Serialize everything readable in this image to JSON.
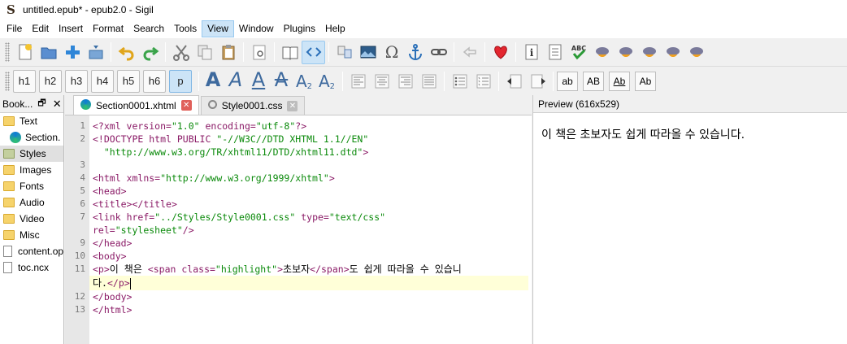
{
  "window": {
    "title": "untitled.epub* - epub2.0 - Sigil",
    "app_icon_glyph": "S"
  },
  "menu": [
    "File",
    "Edit",
    "Insert",
    "Format",
    "Search",
    "Tools",
    "View",
    "Window",
    "Plugins",
    "Help"
  ],
  "menu_active": "View",
  "heading_buttons": [
    "h1",
    "h2",
    "h3",
    "h4",
    "h5",
    "h6",
    "p"
  ],
  "format_glyphs": [
    "A",
    "A",
    "A",
    "A",
    "A",
    "A"
  ],
  "format_subscript": "2",
  "format_superscript": "2",
  "case_buttons": [
    "ab",
    "AB",
    "Ab",
    "Ab"
  ],
  "book_browser": {
    "title": "Book...",
    "items": [
      {
        "label": "Text",
        "kind": "folder"
      },
      {
        "label": "Section.",
        "kind": "xhtml"
      },
      {
        "label": "Styles",
        "kind": "folder-selected"
      },
      {
        "label": "Images",
        "kind": "folder"
      },
      {
        "label": "Fonts",
        "kind": "folder"
      },
      {
        "label": "Audio",
        "kind": "folder"
      },
      {
        "label": "Video",
        "kind": "folder"
      },
      {
        "label": "Misc",
        "kind": "folder"
      },
      {
        "label": "content.op",
        "kind": "file"
      },
      {
        "label": "toc.ncx",
        "kind": "file"
      }
    ]
  },
  "tabs": [
    {
      "label": "Section0001.xhtml",
      "active": true
    },
    {
      "label": "Style0001.css",
      "active": false
    }
  ],
  "code_lines": [
    {
      "n": "1",
      "text": "<?xml version=\"1.0\" encoding=\"utf-8\"?>"
    },
    {
      "n": "2",
      "text": "<!DOCTYPE html PUBLIC \"-//W3C//DTD XHTML 1.1//EN\""
    },
    {
      "n": "",
      "text": "  \"http://www.w3.org/TR/xhtml11/DTD/xhtml11.dtd\">"
    },
    {
      "n": "3",
      "text": ""
    },
    {
      "n": "4",
      "text": "<html xmlns=\"http://www.w3.org/1999/xhtml\">"
    },
    {
      "n": "5",
      "text": "<head>"
    },
    {
      "n": "6",
      "text": "<title></title>"
    },
    {
      "n": "7",
      "text": "<link href=\"../Styles/Style0001.css\" type=\"text/css\""
    },
    {
      "n": "",
      "text": "rel=\"stylesheet\"/>"
    },
    {
      "n": "9",
      "text": "</head>"
    },
    {
      "n": "10",
      "text": "<body>"
    },
    {
      "n": "11",
      "text": "<p>이 책은 <span class=\"highlight\">초보자</span>도 쉽게 따라올 수 있습니"
    },
    {
      "n": "",
      "text": "다.</p>"
    },
    {
      "n": "12",
      "text": "</body>"
    },
    {
      "n": "13",
      "text": "</html>"
    }
  ],
  "preview": {
    "header": "Preview (616x529)",
    "text": "이 책은 초보자도 쉽게 따라올 수 있습니다."
  }
}
